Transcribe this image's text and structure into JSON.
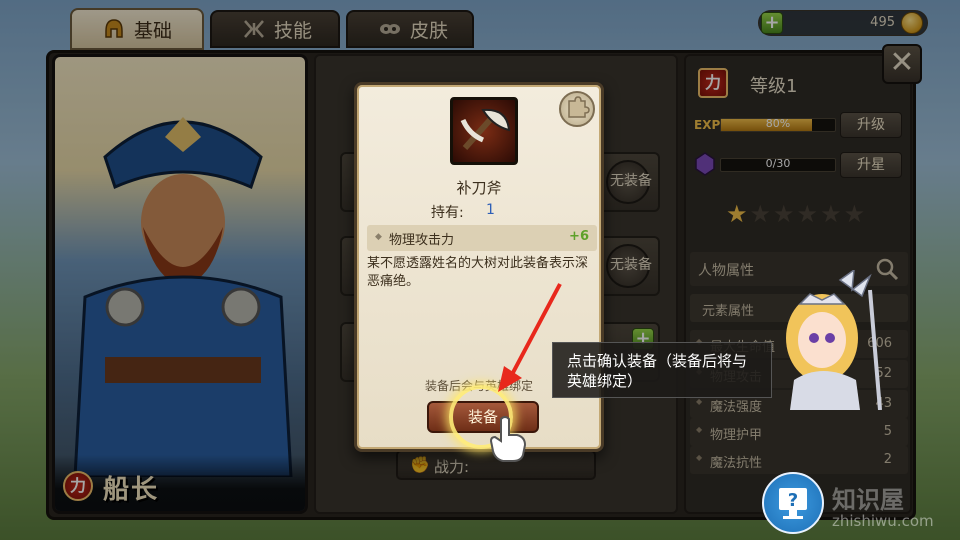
{
  "tabs": [
    {
      "label": "基础",
      "icon": "helmet-icon"
    },
    {
      "label": "技能",
      "icon": "skill-icon"
    },
    {
      "label": "皮肤",
      "icon": "mask-icon"
    }
  ],
  "currency": {
    "gold": "495",
    "icon": "gold-coin-icon"
  },
  "hero": {
    "name": "船长",
    "type": "力"
  },
  "level": {
    "type": "力",
    "label": "等级1"
  },
  "exp": {
    "label": "EXP",
    "progress_text": "80%",
    "progress": 0.8,
    "upgrade_button": "升级"
  },
  "star": {
    "progress_text": "0/30",
    "progress": 0,
    "upstar_button": "升星",
    "stars_total": 6,
    "stars_filled": 1
  },
  "slots": [
    {
      "label": "无装备"
    },
    {
      "label": "无装备"
    }
  ],
  "power": {
    "label": "战力:"
  },
  "attributes": {
    "title": "人物属性",
    "element": "元素属性",
    "rows": [
      {
        "key": "最大生命值",
        "value": "606"
      },
      {
        "key": "物理攻击",
        "value": "52"
      },
      {
        "key": "魔法强度",
        "value": "43"
      },
      {
        "key": "物理护甲",
        "value": "5"
      },
      {
        "key": "魔法抗性",
        "value": "2"
      }
    ]
  },
  "item": {
    "name": "补刀斧",
    "owned_label": "持有:",
    "owned_value": "1",
    "stat_name": "物理攻击力",
    "stat_value": "+6",
    "description": "某不愿透露姓名的大树对此装备表示深恶痛绝。",
    "hint": "装备后会与英雄绑定",
    "equip_button": "装备"
  },
  "tutorial": {
    "text": "点击确认装备（装备后将与英雄绑定）"
  },
  "watermark": {
    "text": "知识屋",
    "sub": "zhishiwu.com"
  },
  "colors": {
    "accent_gold": "#f3c04a",
    "equip_red": "#a5593b",
    "stat_green": "#5ea12a",
    "owned_blue": "#2e5fb7"
  }
}
